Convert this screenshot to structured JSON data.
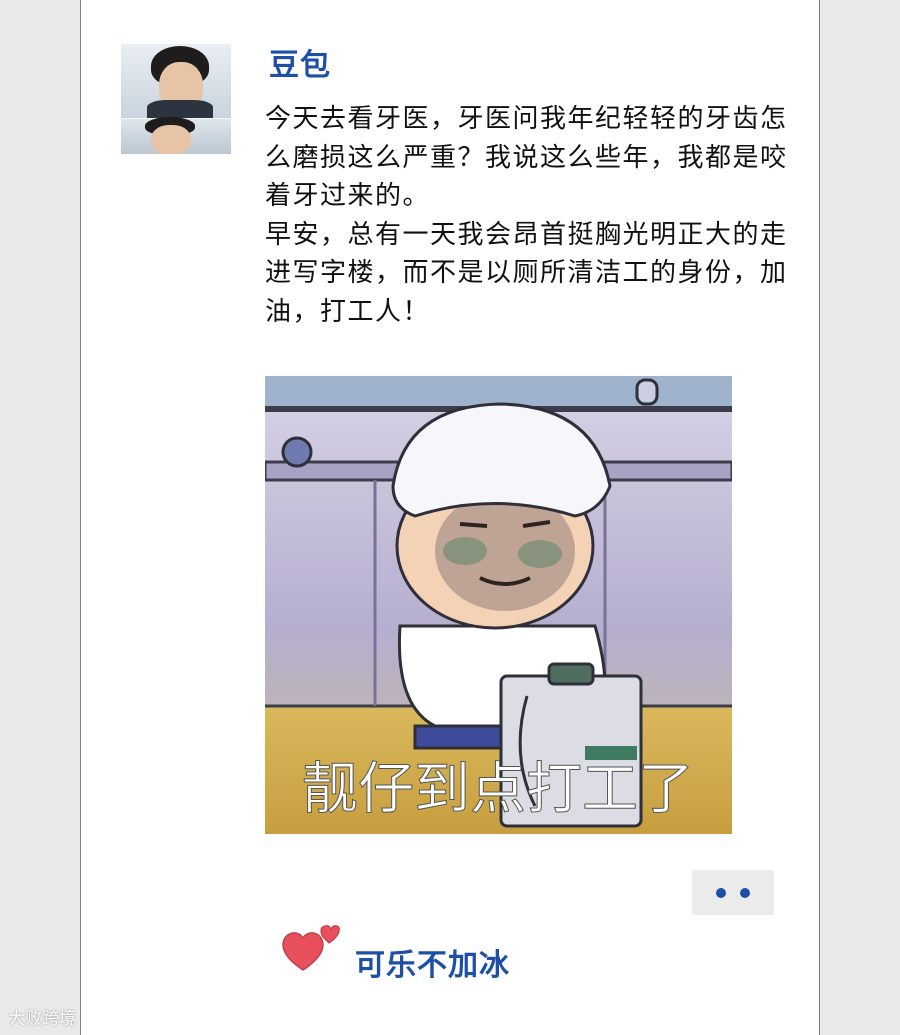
{
  "post": {
    "username": "豆包",
    "paragraphs": [
      "今天去看牙医，牙医问我年纪轻轻的牙齿怎么磨损这么严重？我说这么些年，我都是咬着牙过来的。",
      "早安，总有一天我会昂首挺胸光明正大的走进写字楼，而不是以厕所清洁工的身份，加油，打工人！"
    ],
    "image_caption": "靓仔到点打工了",
    "more_icon": "ellipsis-icon"
  },
  "likes": {
    "icon": "heart-icon",
    "names": "可乐不加冰"
  },
  "watermark": "大败跨境",
  "colors": {
    "accent": "#1e4fa6",
    "heart": "#e8505b",
    "page_bg": "#e9e9e9",
    "card_bg": "#ffffff"
  }
}
